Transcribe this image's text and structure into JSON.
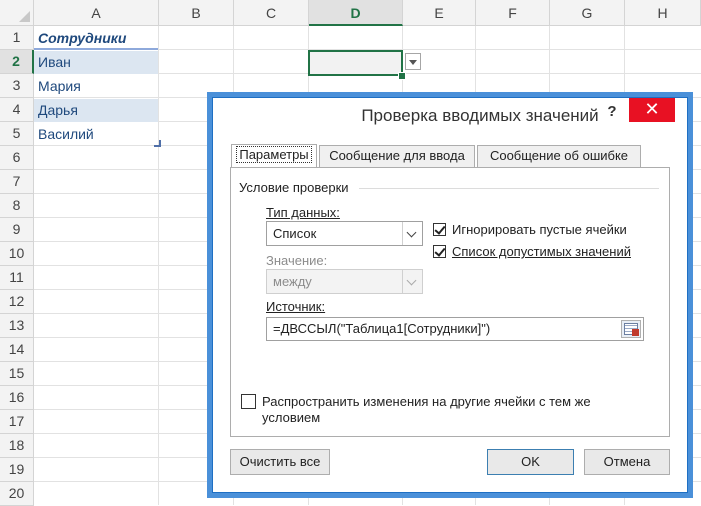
{
  "sheet": {
    "columns": [
      "A",
      "B",
      "C",
      "D",
      "E",
      "F",
      "G",
      "H"
    ],
    "active_column": "D",
    "rows": [
      "1",
      "2",
      "3",
      "4",
      "5",
      "6",
      "7",
      "8",
      "9",
      "10",
      "11",
      "12",
      "13",
      "14",
      "15",
      "16",
      "17",
      "18",
      "19",
      "20"
    ],
    "active_row": "2",
    "cells": {
      "a1": "Сотрудники",
      "a2": "Иван",
      "a3": "Мария",
      "a4": "Дарья",
      "a5": "Василий"
    }
  },
  "dialog": {
    "title": "Проверка вводимых значений",
    "help": "?",
    "close": "✕",
    "tabs": [
      "Параметры",
      "Сообщение для ввода",
      "Сообщение об ошибке"
    ],
    "group_title": "Условие проверки",
    "data_type_label": "Тип данных:",
    "data_type_value": "Список",
    "ignore_blank_label": "Игнорировать пустые ячейки",
    "ignore_blank_checked": true,
    "incell_dropdown_label": "Список допустимых значений",
    "incell_dropdown_checked": true,
    "value_label": "Значение:",
    "value_value": "между",
    "source_label": "Источник:",
    "source_value": "=ДВССЫЛ(\"Таблица1[Сотрудники]\")",
    "apply_label": "Распространить изменения на другие ячейки с тем же условием",
    "apply_checked": false,
    "clear_all": "Очистить все",
    "ok": "OK",
    "cancel": "Отмена"
  },
  "colors": {
    "accent": "#217346",
    "dialog_border": "#4a90d9",
    "close_red": "#e81123",
    "table_band": "#dce6f1"
  }
}
